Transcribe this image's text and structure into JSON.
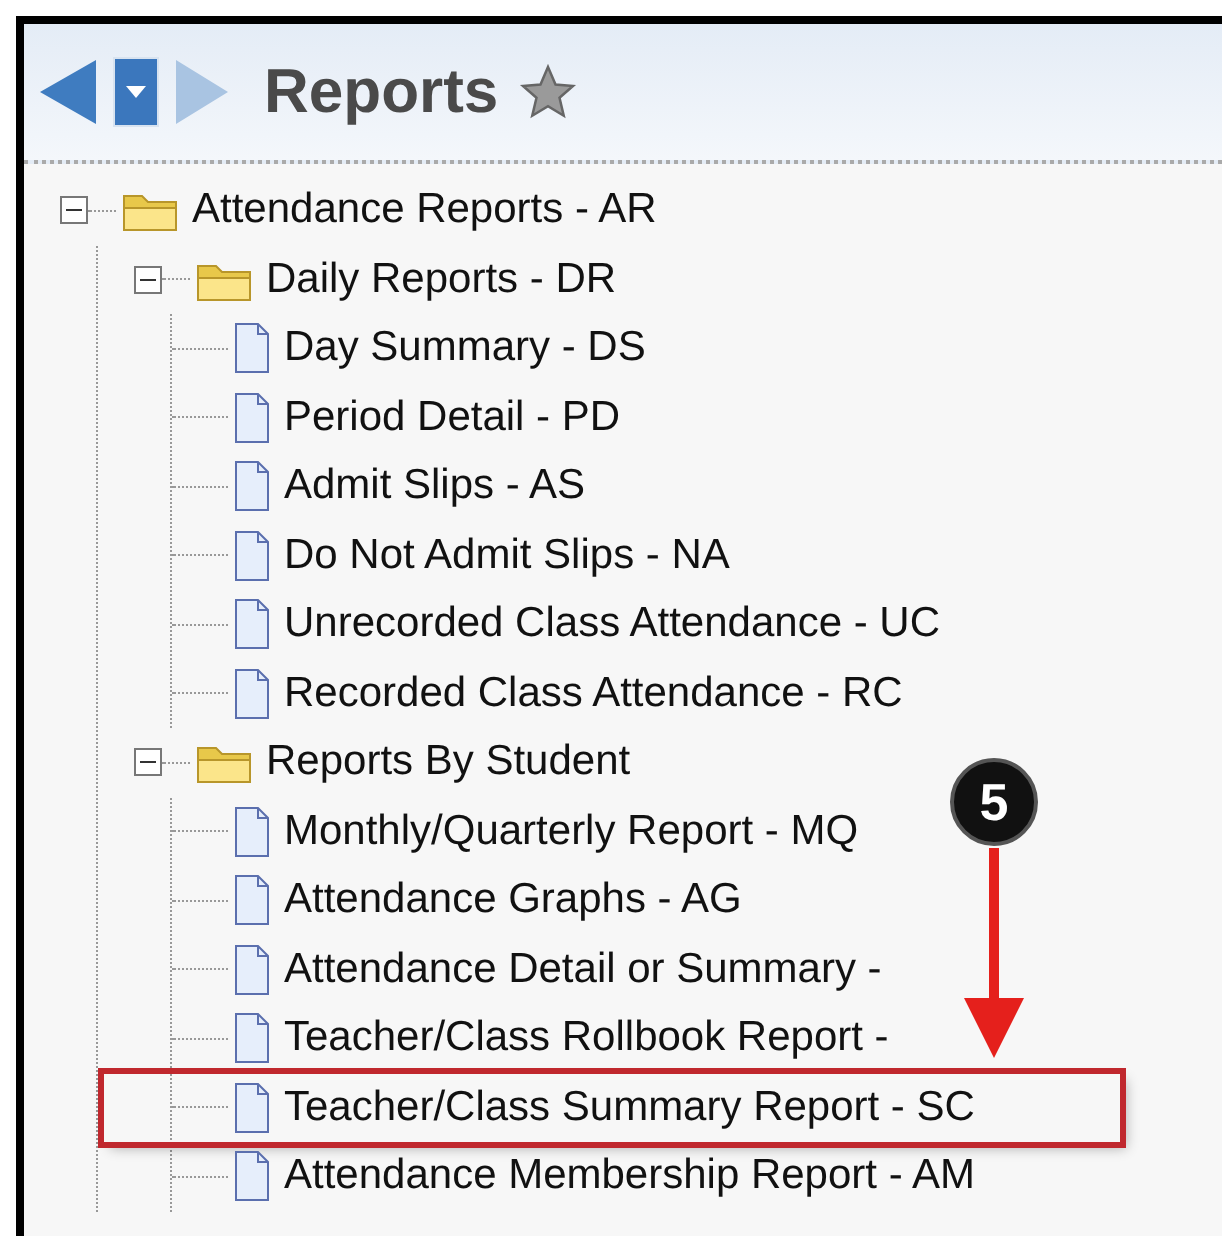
{
  "header": {
    "title": "Reports",
    "favorite": false
  },
  "tree": [
    {
      "label": "Attendance Reports - AR",
      "kind": "folder",
      "expanded": true,
      "children": [
        {
          "label": "Daily Reports - DR",
          "kind": "folder",
          "expanded": true,
          "children": [
            {
              "label": "Day Summary - DS",
              "kind": "report",
              "highlighted": false
            },
            {
              "label": "Period Detail - PD",
              "kind": "report",
              "highlighted": false
            },
            {
              "label": "Admit Slips - AS",
              "kind": "report",
              "highlighted": false
            },
            {
              "label": "Do Not Admit Slips - NA",
              "kind": "report",
              "highlighted": false
            },
            {
              "label": "Unrecorded Class Attendance - UC",
              "kind": "report",
              "highlighted": false
            },
            {
              "label": "Recorded Class Attendance - RC",
              "kind": "report",
              "highlighted": false
            }
          ]
        },
        {
          "label": "Reports By Student",
          "kind": "folder",
          "expanded": true,
          "children": [
            {
              "label": "Monthly/Quarterly Report - MQ",
              "kind": "report",
              "highlighted": false
            },
            {
              "label": "Attendance Graphs - AG",
              "kind": "report",
              "highlighted": false
            },
            {
              "label": "Attendance Detail or Summary -",
              "kind": "report",
              "highlighted": false
            },
            {
              "label": "Teacher/Class Rollbook Report -",
              "kind": "report",
              "highlighted": false
            },
            {
              "label": "Teacher/Class Summary Report - SC",
              "kind": "report",
              "highlighted": true
            },
            {
              "label": "Attendance Membership Report - AM",
              "kind": "report",
              "highlighted": false
            }
          ]
        }
      ]
    }
  ],
  "annotation": {
    "step": "5"
  }
}
